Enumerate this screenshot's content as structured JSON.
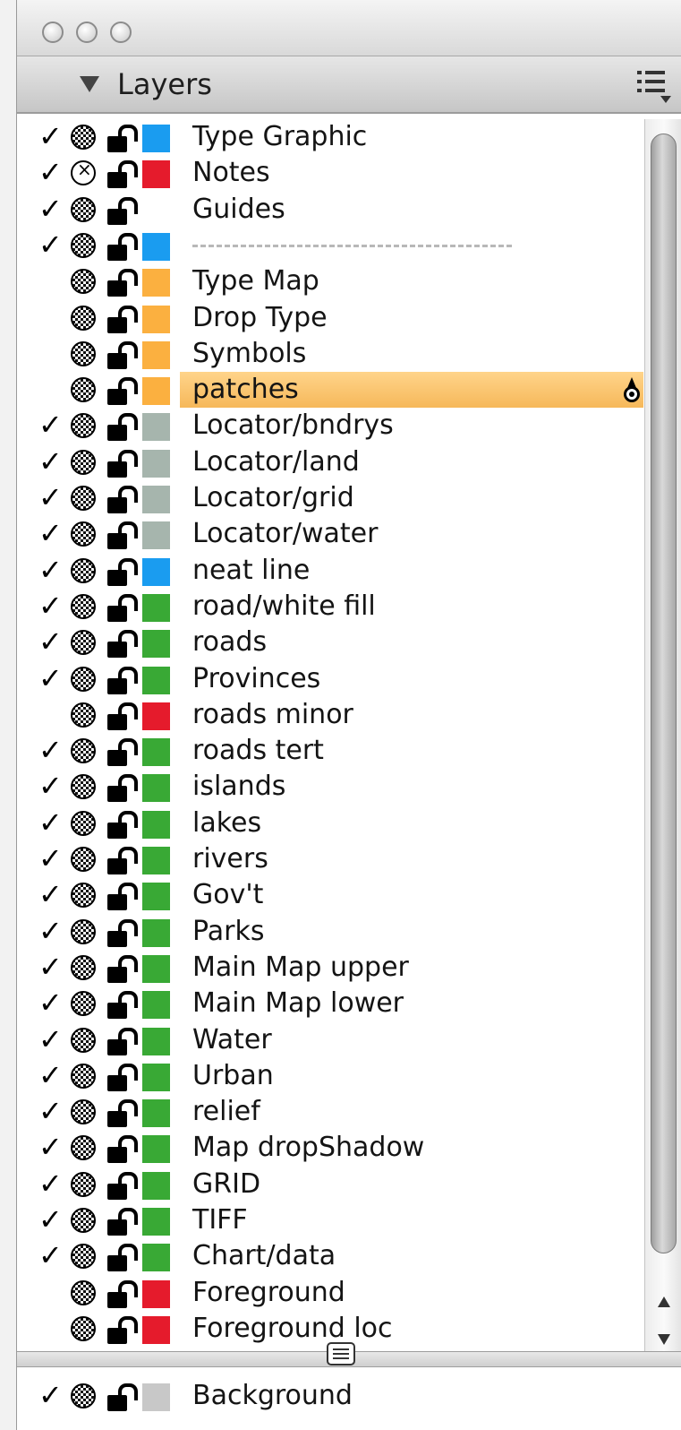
{
  "panel": {
    "title": "Layers"
  },
  "colors": {
    "blue": "#1a9cf0",
    "red": "#e51b2c",
    "orange": "#fbb040",
    "gray": "#a6b5ad",
    "green": "#39a935",
    "selection": "#f6b85a"
  },
  "icons": {
    "visibility": "eye-icon",
    "lock": "lock-open-icon",
    "target": "target-icon",
    "menu": "panel-menu-icon"
  },
  "layers": [
    {
      "label": "Type Graphic",
      "checked": true,
      "eye": "visible",
      "color": "#1a9cf0"
    },
    {
      "label": "Notes",
      "checked": true,
      "eye": "hollow",
      "color": "#e51b2c"
    },
    {
      "label": "Guides",
      "checked": true,
      "eye": "visible",
      "color": ""
    },
    {
      "label": "",
      "checked": true,
      "eye": "visible",
      "color": "#1a9cf0",
      "divider": true
    },
    {
      "label": "Type Map",
      "checked": false,
      "eye": "visible",
      "color": "#fbb040"
    },
    {
      "label": "Drop Type",
      "checked": false,
      "eye": "visible",
      "color": "#fbb040"
    },
    {
      "label": "Symbols",
      "checked": false,
      "eye": "visible",
      "color": "#fbb040"
    },
    {
      "label": "patches",
      "checked": false,
      "eye": "visible",
      "color": "#fbb040",
      "selected": true
    },
    {
      "label": "Locator/bndrys",
      "checked": true,
      "eye": "visible",
      "color": "#a6b5ad"
    },
    {
      "label": "Locator/land",
      "checked": true,
      "eye": "visible",
      "color": "#a6b5ad"
    },
    {
      "label": "Locator/grid",
      "checked": true,
      "eye": "visible",
      "color": "#a6b5ad"
    },
    {
      "label": "Locator/water",
      "checked": true,
      "eye": "visible",
      "color": "#a6b5ad"
    },
    {
      "label": "neat line",
      "checked": true,
      "eye": "visible",
      "color": "#1a9cf0"
    },
    {
      "label": "road/white fill",
      "checked": true,
      "eye": "visible",
      "color": "#39a935"
    },
    {
      "label": "roads",
      "checked": true,
      "eye": "visible",
      "color": "#39a935"
    },
    {
      "label": "Provinces",
      "checked": true,
      "eye": "visible",
      "color": "#39a935"
    },
    {
      "label": "roads minor",
      "checked": false,
      "eye": "visible",
      "color": "#e51b2c"
    },
    {
      "label": "roads tert",
      "checked": true,
      "eye": "visible",
      "color": "#39a935"
    },
    {
      "label": "islands",
      "checked": true,
      "eye": "visible",
      "color": "#39a935"
    },
    {
      "label": "lakes",
      "checked": true,
      "eye": "visible",
      "color": "#39a935"
    },
    {
      "label": "rivers",
      "checked": true,
      "eye": "visible",
      "color": "#39a935"
    },
    {
      "label": "Gov't",
      "checked": true,
      "eye": "visible",
      "color": "#39a935"
    },
    {
      "label": "Parks",
      "checked": true,
      "eye": "visible",
      "color": "#39a935"
    },
    {
      "label": "Main Map upper",
      "checked": true,
      "eye": "visible",
      "color": "#39a935"
    },
    {
      "label": "Main Map lower",
      "checked": true,
      "eye": "visible",
      "color": "#39a935"
    },
    {
      "label": "Water",
      "checked": true,
      "eye": "visible",
      "color": "#39a935"
    },
    {
      "label": "Urban",
      "checked": true,
      "eye": "visible",
      "color": "#39a935"
    },
    {
      "label": "relief",
      "checked": true,
      "eye": "visible",
      "color": "#39a935"
    },
    {
      "label": "Map dropShadow",
      "checked": true,
      "eye": "visible",
      "color": "#39a935"
    },
    {
      "label": "GRID",
      "checked": true,
      "eye": "visible",
      "color": "#39a935"
    },
    {
      "label": "TIFF",
      "checked": true,
      "eye": "visible",
      "color": "#39a935"
    },
    {
      "label": "Chart/data",
      "checked": true,
      "eye": "visible",
      "color": "#39a935"
    },
    {
      "label": "Foreground",
      "checked": false,
      "eye": "visible",
      "color": "#e51b2c"
    },
    {
      "label": "Foreground loc",
      "checked": false,
      "eye": "visible",
      "color": "#e51b2c"
    }
  ],
  "bottom_layer": {
    "label": "Background",
    "checked": true,
    "eye": "visible",
    "color": "#c8c8c8"
  }
}
